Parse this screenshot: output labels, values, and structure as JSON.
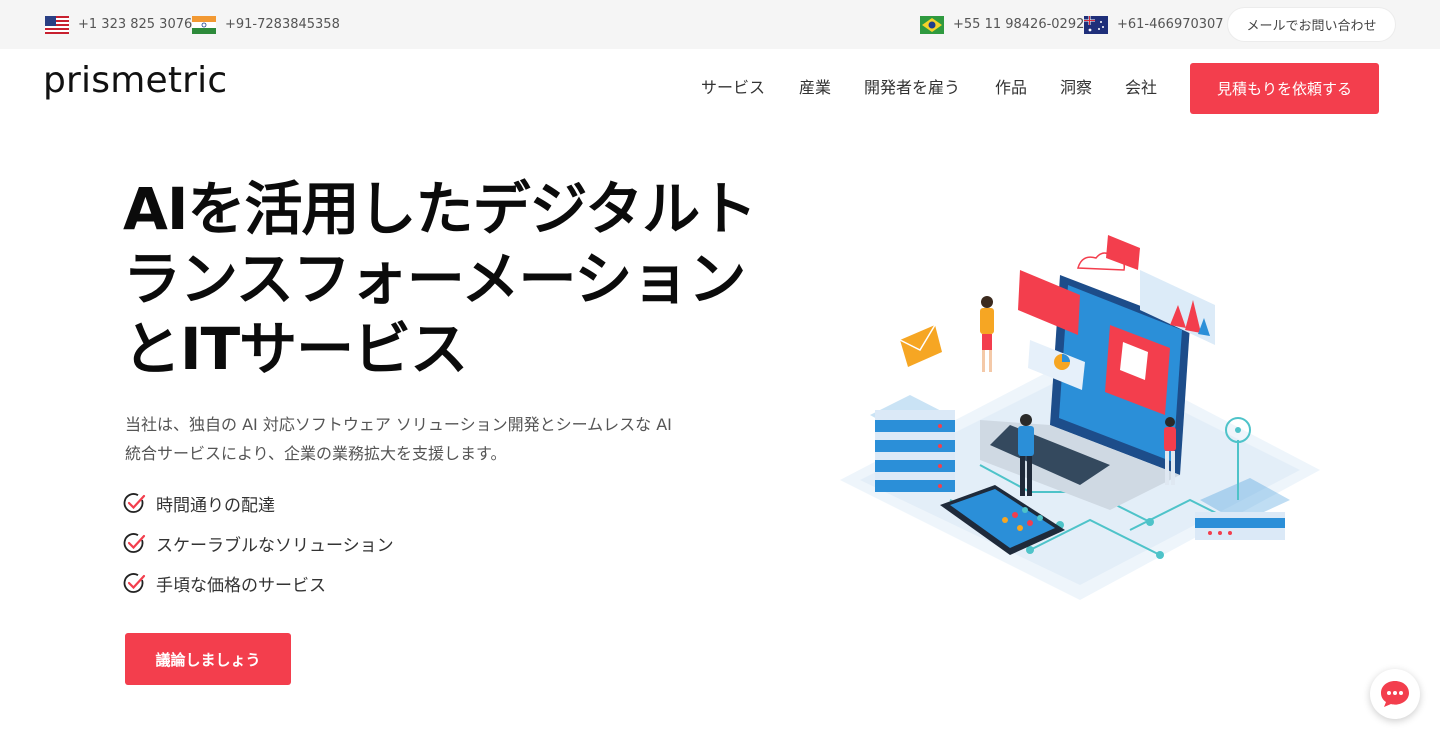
{
  "topbar": {
    "contacts_left": [
      {
        "flag": "us-flag-icon",
        "phone": "+1 323 825 3076"
      },
      {
        "flag": "india-flag-icon",
        "phone": "+91-7283845358"
      }
    ],
    "contacts_right": [
      {
        "flag": "brazil-flag-icon",
        "phone": "+55 11 98426-0292"
      },
      {
        "flag": "australia-flag-icon",
        "phone": "+61-466970307"
      }
    ],
    "mail_label": "メールでお問い合わせ"
  },
  "header": {
    "logo": "prismetric",
    "nav": [
      "サービス",
      "産業",
      "開発者を雇う",
      "作品",
      "洞察",
      "会社"
    ],
    "quote_button": "見積もりを依頼する"
  },
  "hero": {
    "title_lines": [
      "AIを活用したデジタルト",
      "ランスフォーメーション",
      "とITサービス"
    ],
    "description_lines": [
      "当社は、独自の AI 対応ソフトウェア ソリューション開発とシームレスな AI",
      "統合サービスにより、企業の業務拡大を支援します。"
    ],
    "features": [
      "時間通りの配達",
      "スケーラブルなソリューション",
      "手頃な価格のサービス"
    ],
    "cta": "議論しましょう"
  },
  "colors": {
    "accent": "#f33e4d",
    "topbar_bg": "#f5f5f5",
    "illustration_blue": "#2b8fd8"
  },
  "icons": {
    "feature_check": "check-circle-icon",
    "chat": "chat-bubble-icon",
    "illustration": "isometric-it-services-illustration"
  }
}
